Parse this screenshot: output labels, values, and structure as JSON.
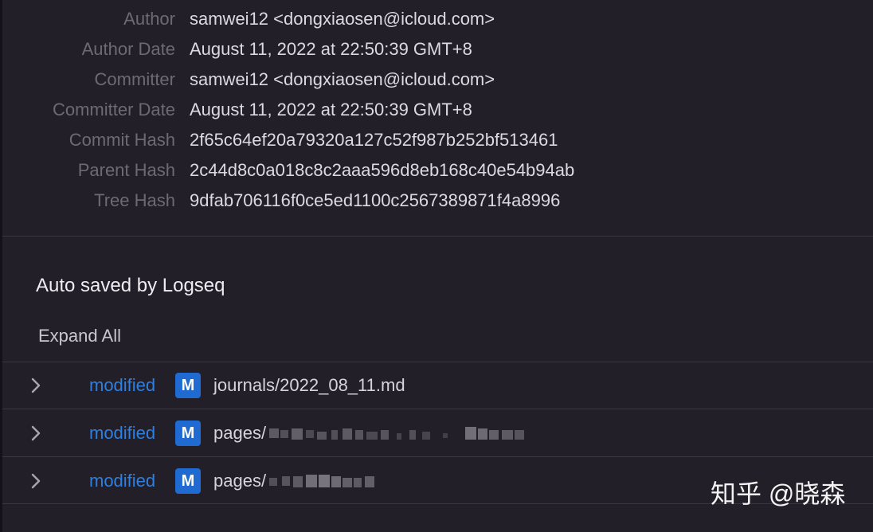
{
  "commit_info": {
    "rows": [
      {
        "label": "Author",
        "value": "samwei12 <dongxiaosen@icloud.com>"
      },
      {
        "label": "Author Date",
        "value": "August 11, 2022 at 22:50:39 GMT+8"
      },
      {
        "label": "Committer",
        "value": "samwei12 <dongxiaosen@icloud.com>"
      },
      {
        "label": "Committer Date",
        "value": "August 11, 2022 at 22:50:39 GMT+8"
      },
      {
        "label": "Commit Hash",
        "value": "2f65c64ef20a79320a127c52f987b252bf513461"
      },
      {
        "label": "Parent Hash",
        "value": "2c44d8c0a018c8c2aaa596d8eb168c40e54b94ab"
      },
      {
        "label": "Tree Hash",
        "value": "9dfab706116f0ce5ed1100c2567389871f4a8996"
      }
    ]
  },
  "commit_message": "Auto saved by Logseq",
  "expand_all_label": "Expand All",
  "files": [
    {
      "status": "modified",
      "badge": "M",
      "path": "journals/2022_08_11.md"
    },
    {
      "status": "modified",
      "badge": "M",
      "path": "pages/"
    },
    {
      "status": "modified",
      "badge": "M",
      "path": "pages/"
    }
  ],
  "colors": {
    "background": "#221f28",
    "label": "#6d6a73",
    "value": "#dcdae0",
    "status_modified": "#2f7fe0",
    "badge_bg": "#1f6bd1"
  },
  "icons": {
    "row_toggle": "chevron-right-icon"
  },
  "watermark": "知乎 @晓森"
}
